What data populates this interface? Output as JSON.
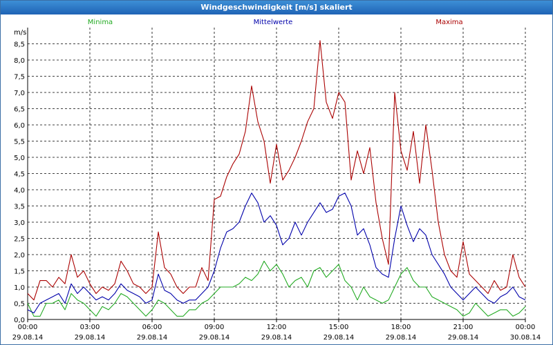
{
  "window": {
    "title": "Windgeschwindigkeit [m/s] skaliert"
  },
  "chart_data": {
    "type": "line",
    "title": "Windgeschwindigkeit [m/s] skaliert",
    "ylabel": "m/s",
    "ylim": [
      0,
      9
    ],
    "xlim": [
      "29.08.14 00:00",
      "30.08.14 00:00"
    ],
    "grid": true,
    "legend_position": "top",
    "y_ticks": [
      "0,0",
      "0,5",
      "1,0",
      "1,5",
      "2,0",
      "2,5",
      "3,0",
      "3,5",
      "4,0",
      "4,5",
      "5,0",
      "5,5",
      "6,0",
      "6,5",
      "7,0",
      "7,5",
      "8,0",
      "8,5"
    ],
    "x_ticks": [
      {
        "time": "00:00",
        "date": "29.08.14"
      },
      {
        "time": "03:00",
        "date": "29.08.14"
      },
      {
        "time": "06:00",
        "date": "29.08.14"
      },
      {
        "time": "09:00",
        "date": "29.08.14"
      },
      {
        "time": "12:00",
        "date": "29.08.14"
      },
      {
        "time": "15:00",
        "date": "29.08.14"
      },
      {
        "time": "18:00",
        "date": "29.08.14"
      },
      {
        "time": "21:00",
        "date": "29.08.14"
      },
      {
        "time": "00:00",
        "date": "30.08.14"
      }
    ],
    "series": [
      {
        "name": "Minima",
        "color": "#22aa22",
        "points": [
          [
            0,
            0.5
          ],
          [
            0.3,
            0.1
          ],
          [
            0.6,
            0.1
          ],
          [
            0.9,
            0.5
          ],
          [
            1.2,
            0.5
          ],
          [
            1.5,
            0.6
          ],
          [
            1.8,
            0.3
          ],
          [
            2.1,
            0.8
          ],
          [
            2.4,
            0.6
          ],
          [
            2.7,
            0.5
          ],
          [
            3.0,
            0.3
          ],
          [
            3.3,
            0.1
          ],
          [
            3.6,
            0.4
          ],
          [
            3.9,
            0.3
          ],
          [
            4.2,
            0.5
          ],
          [
            4.5,
            0.8
          ],
          [
            4.8,
            0.7
          ],
          [
            5.1,
            0.5
          ],
          [
            5.4,
            0.3
          ],
          [
            5.7,
            0.1
          ],
          [
            6.0,
            0.3
          ],
          [
            6.3,
            0.6
          ],
          [
            6.6,
            0.5
          ],
          [
            6.9,
            0.3
          ],
          [
            7.2,
            0.1
          ],
          [
            7.5,
            0.1
          ],
          [
            7.8,
            0.3
          ],
          [
            8.1,
            0.3
          ],
          [
            8.4,
            0.5
          ],
          [
            8.7,
            0.6
          ],
          [
            9.0,
            0.8
          ],
          [
            9.3,
            1.0
          ],
          [
            9.6,
            1.0
          ],
          [
            9.9,
            1.0
          ],
          [
            10.2,
            1.1
          ],
          [
            10.5,
            1.3
          ],
          [
            10.8,
            1.2
          ],
          [
            11.1,
            1.4
          ],
          [
            11.4,
            1.8
          ],
          [
            11.7,
            1.5
          ],
          [
            12.0,
            1.7
          ],
          [
            12.3,
            1.4
          ],
          [
            12.6,
            1.0
          ],
          [
            12.9,
            1.2
          ],
          [
            13.2,
            1.3
          ],
          [
            13.5,
            1.0
          ],
          [
            13.8,
            1.5
          ],
          [
            14.1,
            1.6
          ],
          [
            14.4,
            1.3
          ],
          [
            14.7,
            1.5
          ],
          [
            15.0,
            1.7
          ],
          [
            15.3,
            1.2
          ],
          [
            15.6,
            1.0
          ],
          [
            15.9,
            0.6
          ],
          [
            16.2,
            1.0
          ],
          [
            16.5,
            0.7
          ],
          [
            16.8,
            0.6
          ],
          [
            17.1,
            0.5
          ],
          [
            17.4,
            0.6
          ],
          [
            17.7,
            1.0
          ],
          [
            18.0,
            1.4
          ],
          [
            18.3,
            1.6
          ],
          [
            18.6,
            1.2
          ],
          [
            18.9,
            1.0
          ],
          [
            19.2,
            1.0
          ],
          [
            19.5,
            0.7
          ],
          [
            19.8,
            0.6
          ],
          [
            20.1,
            0.5
          ],
          [
            20.4,
            0.4
          ],
          [
            20.7,
            0.3
          ],
          [
            21.0,
            0.1
          ],
          [
            21.3,
            0.2
          ],
          [
            21.6,
            0.5
          ],
          [
            21.9,
            0.3
          ],
          [
            22.2,
            0.1
          ],
          [
            22.5,
            0.2
          ],
          [
            22.8,
            0.3
          ],
          [
            23.1,
            0.3
          ],
          [
            23.4,
            0.1
          ],
          [
            23.7,
            0.2
          ],
          [
            24.0,
            0.4
          ]
        ]
      },
      {
        "name": "Mittelwerte",
        "color": "#0000aa",
        "points": [
          [
            0,
            0.3
          ],
          [
            0.3,
            0.2
          ],
          [
            0.6,
            0.5
          ],
          [
            0.9,
            0.6
          ],
          [
            1.2,
            0.7
          ],
          [
            1.5,
            0.8
          ],
          [
            1.8,
            0.5
          ],
          [
            2.1,
            1.1
          ],
          [
            2.4,
            0.8
          ],
          [
            2.7,
            1.0
          ],
          [
            3.0,
            0.8
          ],
          [
            3.3,
            0.6
          ],
          [
            3.6,
            0.7
          ],
          [
            3.9,
            0.6
          ],
          [
            4.2,
            0.8
          ],
          [
            4.5,
            1.1
          ],
          [
            4.8,
            0.9
          ],
          [
            5.1,
            0.8
          ],
          [
            5.4,
            0.7
          ],
          [
            5.7,
            0.5
          ],
          [
            6.0,
            0.6
          ],
          [
            6.3,
            1.4
          ],
          [
            6.6,
            0.9
          ],
          [
            6.9,
            0.8
          ],
          [
            7.2,
            0.6
          ],
          [
            7.5,
            0.5
          ],
          [
            7.8,
            0.6
          ],
          [
            8.1,
            0.6
          ],
          [
            8.4,
            0.8
          ],
          [
            8.7,
            1.0
          ],
          [
            9.0,
            1.5
          ],
          [
            9.3,
            2.2
          ],
          [
            9.6,
            2.7
          ],
          [
            9.9,
            2.8
          ],
          [
            10.2,
            3.0
          ],
          [
            10.5,
            3.5
          ],
          [
            10.8,
            3.9
          ],
          [
            11.1,
            3.6
          ],
          [
            11.4,
            3.0
          ],
          [
            11.7,
            3.2
          ],
          [
            12.0,
            2.9
          ],
          [
            12.3,
            2.3
          ],
          [
            12.6,
            2.5
          ],
          [
            12.9,
            3.0
          ],
          [
            13.2,
            2.6
          ],
          [
            13.5,
            3.0
          ],
          [
            13.8,
            3.3
          ],
          [
            14.1,
            3.6
          ],
          [
            14.4,
            3.3
          ],
          [
            14.7,
            3.4
          ],
          [
            15.0,
            3.8
          ],
          [
            15.3,
            3.9
          ],
          [
            15.6,
            3.5
          ],
          [
            15.9,
            2.6
          ],
          [
            16.2,
            2.8
          ],
          [
            16.5,
            2.3
          ],
          [
            16.8,
            1.6
          ],
          [
            17.1,
            1.4
          ],
          [
            17.4,
            1.3
          ],
          [
            17.7,
            2.5
          ],
          [
            18.0,
            3.5
          ],
          [
            18.3,
            2.9
          ],
          [
            18.6,
            2.4
          ],
          [
            18.9,
            2.8
          ],
          [
            19.2,
            2.6
          ],
          [
            19.5,
            2.0
          ],
          [
            19.8,
            1.7
          ],
          [
            20.1,
            1.4
          ],
          [
            20.4,
            1.0
          ],
          [
            20.7,
            0.8
          ],
          [
            21.0,
            0.6
          ],
          [
            21.3,
            0.8
          ],
          [
            21.6,
            1.0
          ],
          [
            21.9,
            0.8
          ],
          [
            22.2,
            0.6
          ],
          [
            22.5,
            0.5
          ],
          [
            22.8,
            0.7
          ],
          [
            23.1,
            0.8
          ],
          [
            23.4,
            1.0
          ],
          [
            23.7,
            0.7
          ],
          [
            24.0,
            0.6
          ]
        ]
      },
      {
        "name": "Maxima",
        "color": "#aa0000",
        "points": [
          [
            0,
            0.8
          ],
          [
            0.3,
            0.6
          ],
          [
            0.6,
            1.2
          ],
          [
            0.9,
            1.2
          ],
          [
            1.2,
            1.0
          ],
          [
            1.5,
            1.3
          ],
          [
            1.8,
            1.1
          ],
          [
            2.1,
            2.0
          ],
          [
            2.4,
            1.3
          ],
          [
            2.7,
            1.5
          ],
          [
            3.0,
            1.1
          ],
          [
            3.3,
            0.8
          ],
          [
            3.6,
            1.0
          ],
          [
            3.9,
            0.9
          ],
          [
            4.2,
            1.1
          ],
          [
            4.5,
            1.8
          ],
          [
            4.8,
            1.5
          ],
          [
            5.1,
            1.1
          ],
          [
            5.4,
            1.0
          ],
          [
            5.7,
            0.8
          ],
          [
            6.0,
            1.0
          ],
          [
            6.3,
            2.7
          ],
          [
            6.6,
            1.6
          ],
          [
            6.9,
            1.4
          ],
          [
            7.2,
            1.0
          ],
          [
            7.5,
            0.8
          ],
          [
            7.8,
            1.0
          ],
          [
            8.1,
            1.0
          ],
          [
            8.4,
            1.6
          ],
          [
            8.7,
            1.2
          ],
          [
            9.0,
            3.7
          ],
          [
            9.3,
            3.8
          ],
          [
            9.6,
            4.4
          ],
          [
            9.9,
            4.8
          ],
          [
            10.2,
            5.1
          ],
          [
            10.5,
            5.8
          ],
          [
            10.8,
            7.2
          ],
          [
            11.1,
            6.1
          ],
          [
            11.4,
            5.5
          ],
          [
            11.7,
            4.2
          ],
          [
            12.0,
            5.4
          ],
          [
            12.3,
            4.3
          ],
          [
            12.6,
            4.6
          ],
          [
            12.9,
            5.0
          ],
          [
            13.2,
            5.5
          ],
          [
            13.5,
            6.1
          ],
          [
            13.8,
            6.5
          ],
          [
            14.1,
            8.6
          ],
          [
            14.4,
            6.7
          ],
          [
            14.7,
            6.2
          ],
          [
            15.0,
            7.0
          ],
          [
            15.3,
            6.7
          ],
          [
            15.6,
            4.3
          ],
          [
            15.9,
            5.2
          ],
          [
            16.2,
            4.5
          ],
          [
            16.5,
            5.3
          ],
          [
            16.8,
            3.6
          ],
          [
            17.1,
            2.5
          ],
          [
            17.4,
            1.7
          ],
          [
            17.7,
            7.0
          ],
          [
            18.0,
            5.2
          ],
          [
            18.3,
            4.6
          ],
          [
            18.6,
            5.8
          ],
          [
            18.9,
            4.2
          ],
          [
            19.2,
            6.0
          ],
          [
            19.5,
            4.6
          ],
          [
            19.8,
            3.0
          ],
          [
            20.1,
            2.0
          ],
          [
            20.4,
            1.5
          ],
          [
            20.7,
            1.3
          ],
          [
            21.0,
            2.4
          ],
          [
            21.3,
            1.4
          ],
          [
            21.6,
            1.2
          ],
          [
            21.9,
            1.0
          ],
          [
            22.2,
            0.8
          ],
          [
            22.5,
            1.2
          ],
          [
            22.8,
            0.9
          ],
          [
            23.1,
            1.0
          ],
          [
            23.4,
            2.0
          ],
          [
            23.7,
            1.3
          ],
          [
            24.0,
            1.0
          ]
        ]
      }
    ]
  }
}
